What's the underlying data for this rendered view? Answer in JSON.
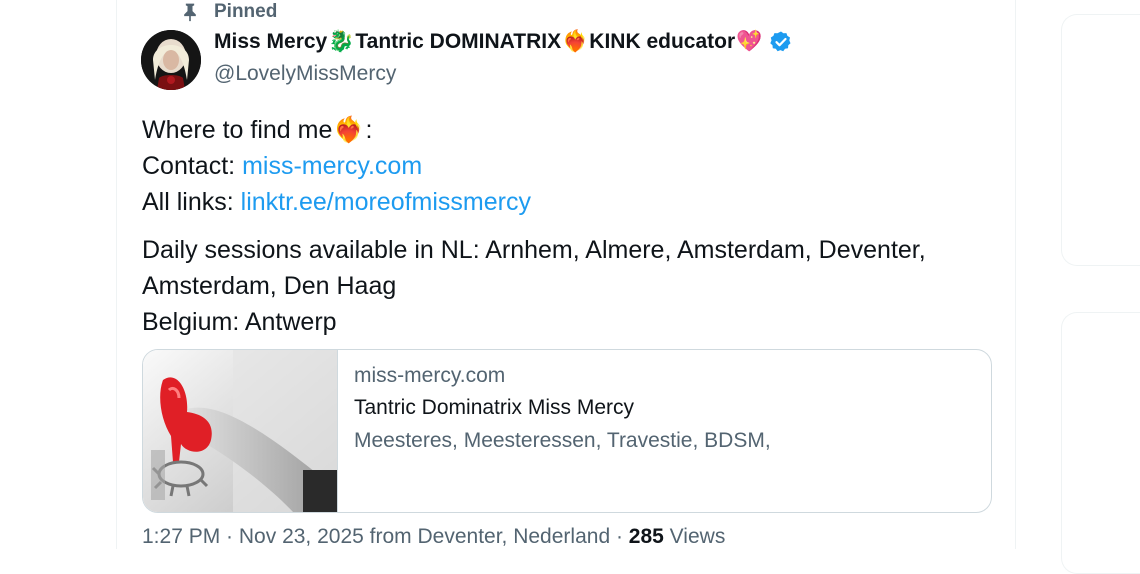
{
  "tweet": {
    "pinned_label": "Pinned",
    "author": {
      "name_part1": "Miss Mercy",
      "emoji_dragon": "🐉",
      "name_part2": "Tantric DOMINATRIX",
      "emoji_heart_fire": "❤️‍🔥",
      "name_part3": "KINK educator",
      "emoji_sparkling_heart": "💖",
      "handle": "@LovelyMissMercy",
      "verified": true
    },
    "body": {
      "line1_text": "Where to find me",
      "line1_emoji": "❤️‍🔥",
      "line1_suffix": ":",
      "contact_label": "Contact: ",
      "contact_link": "miss-mercy.com",
      "links_label": "All links: ",
      "links_link": "linktr.ee/moreofmissmercy",
      "sessions_line1": "Daily sessions available in NL: Arnhem, Almere, Amsterdam, Deventer,",
      "sessions_line2": "Amsterdam, Den Haag",
      "sessions_line3": "Belgium: Antwerp"
    },
    "link_card": {
      "domain": "miss-mercy.com",
      "title": "Tantric Dominatrix Miss Mercy",
      "description": "Meesteres, Meesteressen, Travestie, BDSM,"
    },
    "meta": {
      "time": "1:27 PM",
      "separator": " · ",
      "date": "Nov 23, 2025",
      "from_text": " from Deventer, Nederland",
      "views_count": "285",
      "views_label": " Views"
    }
  },
  "colors": {
    "link": "#1d9bf0",
    "secondary_text": "#536471",
    "verified": "#1d9bf0"
  }
}
